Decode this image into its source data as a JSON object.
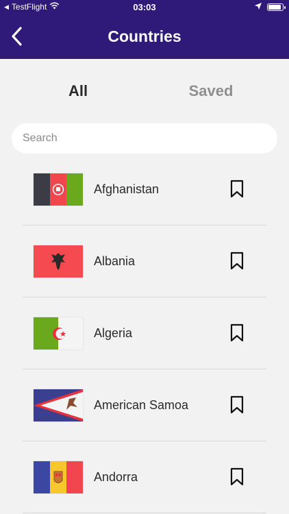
{
  "status_bar": {
    "carrier": "TestFlight",
    "time": "03:03",
    "icons": [
      "back-arrow-icon",
      "wifi-icon",
      "location-arrow-icon",
      "battery-icon"
    ]
  },
  "navbar": {
    "title": "Countries",
    "back_icon": "chevron-left-icon"
  },
  "tabs": [
    {
      "label": "All",
      "active": true
    },
    {
      "label": "Saved",
      "active": false
    }
  ],
  "search": {
    "placeholder": "Search",
    "value": ""
  },
  "countries": [
    {
      "name": "Afghanistan",
      "flag": "afghanistan-flag",
      "saved": false
    },
    {
      "name": "Albania",
      "flag": "albania-flag",
      "saved": false
    },
    {
      "name": "Algeria",
      "flag": "algeria-flag",
      "saved": false
    },
    {
      "name": "American Samoa",
      "flag": "american-samoa-flag",
      "saved": false
    },
    {
      "name": "Andorra",
      "flag": "andorra-flag",
      "saved": false
    }
  ],
  "colors": {
    "header_bg": "#2f1a79",
    "page_bg": "#f2f2f2",
    "tab_active": "#2a2a2a",
    "tab_inactive": "#8f8f8f"
  }
}
